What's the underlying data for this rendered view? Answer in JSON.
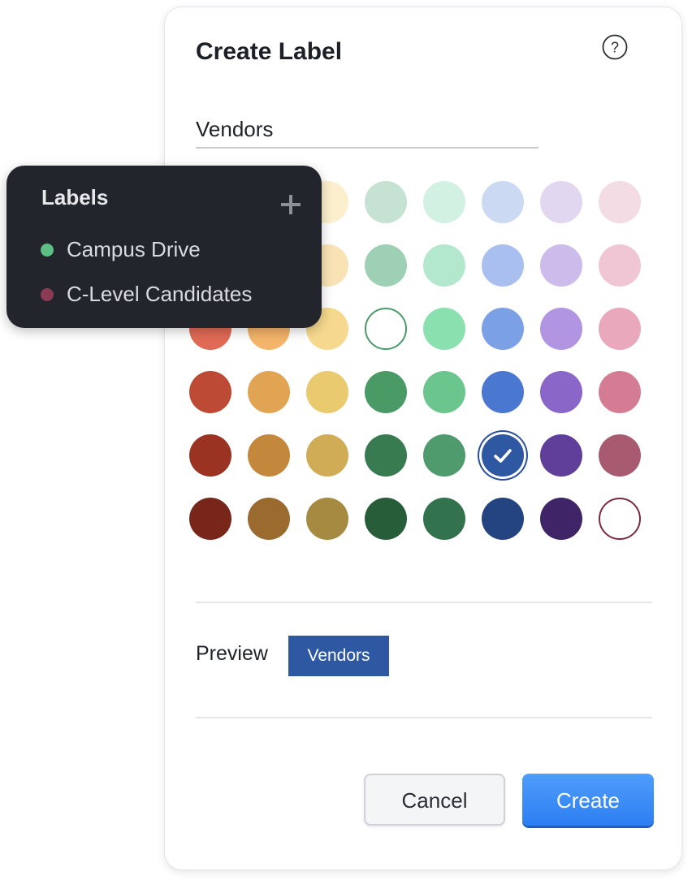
{
  "dialog": {
    "title": "Create Label",
    "help_icon": "question-circle-icon",
    "name_value": "Vendors",
    "selected_color": "#2f58a3",
    "preview_label": "Preview",
    "preview_chip_text": "Vendors",
    "cancel_label": "Cancel",
    "create_label": "Create"
  },
  "palette": {
    "rows": [
      [
        "#f8dcd5",
        "#fbe2c8",
        "#fcefcd",
        "#c5e2d2",
        "#d2f1e2",
        "#ccd9f2",
        "#e1d7f1",
        "#f4dce4"
      ],
      [
        "#f4c3b7",
        "#f8d3a8",
        "#f9e3b5",
        "#9dd0b4",
        "#b3e8cf",
        "#a8bff0",
        "#cdbbec",
        "#f0c6d5"
      ],
      [
        "#e06a55",
        "#f4b46a",
        "#f6d98e",
        "#ffffff",
        "#8be0b0",
        "#7ba0e6",
        "#b195e3",
        "#eaa8bd"
      ],
      [
        "#bc4a35",
        "#e0a452",
        "#eaca6e",
        "#4a9a66",
        "#6ac68d",
        "#4a78d1",
        "#8b66c9",
        "#d57c95"
      ],
      [
        "#9a3322",
        "#c4883d",
        "#d1ac56",
        "#397b50",
        "#4f9b6d",
        "#2f58a3",
        "#5f3f99",
        "#a85b70"
      ],
      [
        "#772619",
        "#9a6a2e",
        "#a68a42",
        "#275e39",
        "#32734d",
        "#244481",
        "#3f2568",
        "#ffffff"
      ]
    ],
    "outlined": {
      "2-3": "#4a9a66",
      "5-7": "#7a2a3f"
    },
    "selected": "4-5"
  },
  "labels_panel": {
    "title": "Labels",
    "add_icon": "plus-icon",
    "items": [
      {
        "label": "Campus Drive",
        "color": "#5dbf83"
      },
      {
        "label": "C-Level Candidates",
        "color": "#8a3a52"
      }
    ]
  }
}
